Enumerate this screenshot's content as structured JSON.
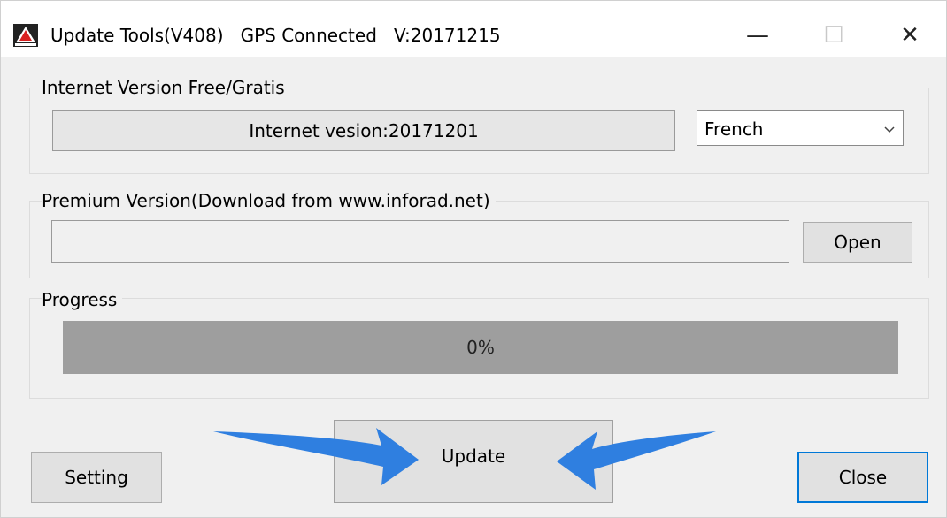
{
  "window": {
    "title": "Update Tools(V408)   GPS Connected   V:20171215",
    "minimize_glyph": "—",
    "maximize_glyph": "☐",
    "close_glyph": "✕"
  },
  "internet_group": {
    "label": "Internet Version Free/Gratis",
    "version_text": "Internet vesion:20171201",
    "language": "French"
  },
  "premium_group": {
    "label": "Premium Version(Download from www.inforad.net)",
    "path_value": "",
    "open_label": "Open"
  },
  "progress_group": {
    "label": "Progress",
    "value": 0,
    "text": "0%"
  },
  "buttons": {
    "setting_label": "Setting",
    "update_label": "Update",
    "close_label": "Close"
  },
  "colors": {
    "accent": "#0078d7",
    "arrow": "#2f7fe0"
  },
  "icons": {
    "app": "warning-triangle-icon",
    "dropdown": "chevron-down-icon"
  }
}
